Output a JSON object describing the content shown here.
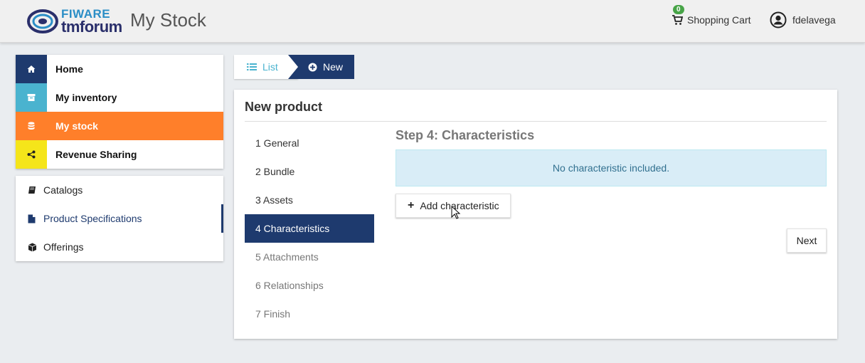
{
  "header": {
    "logo_top": "FIWARE",
    "logo_bottom": "tmforum",
    "title": "My Stock",
    "cart_label": "Shopping Cart",
    "cart_count": "0",
    "username": "fdelavega"
  },
  "nav": {
    "items": [
      {
        "label": "Home",
        "icon": "home-icon",
        "color": "#1e3a6e"
      },
      {
        "label": "My inventory",
        "icon": "archive-icon",
        "color": "#4ab3cf"
      },
      {
        "label": "My stock",
        "icon": "database-icon",
        "color": "#ff7f2a"
      },
      {
        "label": "Revenue Sharing",
        "icon": "share-icon",
        "color": "#f5e51a"
      }
    ]
  },
  "subnav": {
    "items": [
      {
        "label": "Catalogs",
        "icon": "book-icon"
      },
      {
        "label": "Product Specifications",
        "icon": "file-icon"
      },
      {
        "label": "Offerings",
        "icon": "cube-icon"
      }
    ]
  },
  "crumbs": {
    "list_label": "List",
    "new_label": "New"
  },
  "panel": {
    "title": "New product",
    "steps": [
      "1 General",
      "2 Bundle",
      "3 Assets",
      "4 Characteristics",
      "5 Attachments",
      "6 Relationships",
      "7 Finish"
    ],
    "step_title": "Step 4: Characteristics",
    "alert": "No characteristic included.",
    "add_label": "Add characteristic",
    "next_label": "Next"
  }
}
